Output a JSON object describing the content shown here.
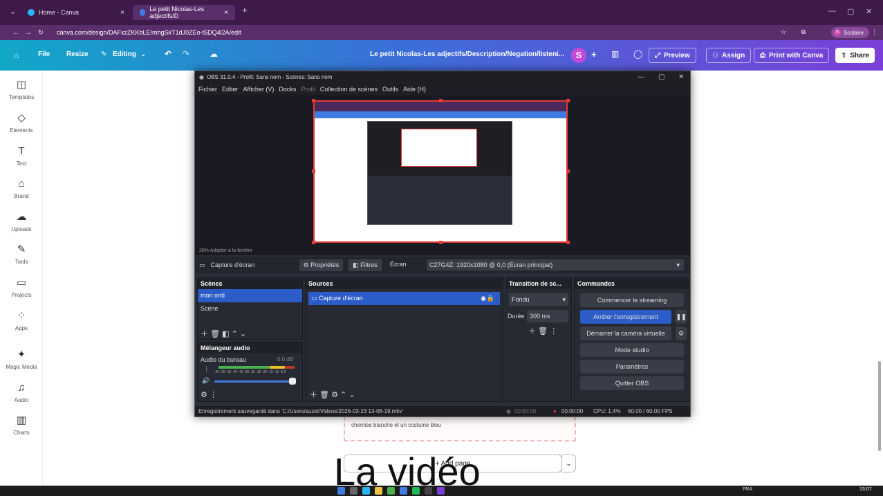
{
  "browser": {
    "tabs": [
      {
        "title": "Home - Canva",
        "active": false
      },
      {
        "title": "Le petit Nicolas-Les adjectifs/D",
        "active": true
      }
    ],
    "url": "canva.com/design/DAFxzZKKbLE/mhgSkT1dJ0ZEo-t5DQ4l2A/edit",
    "profile_label": "Scolaire",
    "profile_initial": "S"
  },
  "canva_header": {
    "file": "File",
    "resize": "Resize",
    "editing": "Editing",
    "doc_title": "Le petit Nicolas-Les adjectifs/Description/Negation/listeni...",
    "avatar_initial": "S",
    "preview": "Preview",
    "assign": "Assign",
    "print": "Print with Canva",
    "share": "Share"
  },
  "sidebar": {
    "items": [
      {
        "label": "Templates",
        "icon": "◫"
      },
      {
        "label": "Elements",
        "icon": "◇"
      },
      {
        "label": "Text",
        "icon": "T"
      },
      {
        "label": "Brand",
        "icon": "⌂"
      },
      {
        "label": "Uploads",
        "icon": "☁"
      },
      {
        "label": "Tools",
        "icon": "✎"
      },
      {
        "label": "Projects",
        "icon": "▭"
      },
      {
        "label": "Apps",
        "icon": "⁘"
      },
      {
        "label": "Magic Media",
        "icon": "✦"
      },
      {
        "label": "Audio",
        "icon": "♫"
      },
      {
        "label": "Charts",
        "icon": "▥"
      }
    ]
  },
  "document": {
    "text_line": "chemise blanche et un costume bleu",
    "add_page": "+ Add page"
  },
  "caption": "La vidéo",
  "obs": {
    "title": "OBS 31.0.4 - Profil: Sans nom - Scènes: Sans nom",
    "menu": [
      "Fichier",
      "Editer",
      "Afficher (V)",
      "Docks",
      "Profil",
      "Collection de scènes",
      "Outils",
      "Aide (H)"
    ],
    "zoom_label": "28%  Adapter à la fenêtre",
    "source_name": "Capture d'écran",
    "properties": "Propriétés",
    "filters": "Filtres",
    "screen_label": "Écran",
    "screen_value": "C27G4Z: 1920x1080 @ 0,0 (Écran principal)",
    "scenes": {
      "header": "Scènes",
      "items": [
        "mon ordi",
        "Scène"
      ]
    },
    "sources": {
      "header": "Sources",
      "items": [
        "Capture d'écran"
      ]
    },
    "transition": {
      "header": "Transition de sc...",
      "type": "Fondu",
      "duration_label": "Durée",
      "duration": "300 ms"
    },
    "mixer": {
      "header": "Mélangeur audio",
      "channel": "Audio du bureau",
      "level": "0.0 dB",
      "scale": "-60 -55 -50 -45 -40 -35 -30 -25 -20 -15 -10 -5 0"
    },
    "commands": {
      "header": "Commandes",
      "start_stream": "Commencer le streaming",
      "stop_record": "Arrêter l'enregistrement",
      "virtual_cam": "Démarrer la caméra virtuelle",
      "studio": "Mode studio",
      "settings": "Paramètres",
      "quit": "Quitter OBS"
    },
    "status": {
      "saved": "Enregistrement sauvegardé dans 'C:/Users/suzel/Videos/2026-03-23 13-06-19.mkv'",
      "stream_time": "00:00:00",
      "rec_time": "00:00:00",
      "cpu": "CPU: 1.4%",
      "fps": "60.00 / 60.00 FPS"
    }
  },
  "taskbar": {
    "time": "13:07",
    "tray": "FRA"
  },
  "colors": {
    "accent": "#2b5cc8",
    "record": "#e53935",
    "canva_gradient_start": "#11a8c8",
    "canva_gradient_end": "#7a3fd8"
  }
}
